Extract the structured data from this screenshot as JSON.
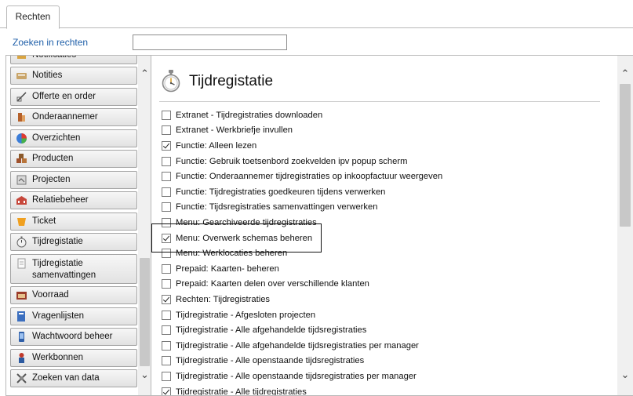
{
  "tabs": {
    "active_label": "Rechten"
  },
  "search": {
    "label": "Zoeken in rechten",
    "value": "",
    "placeholder": ""
  },
  "sidebar": {
    "items": [
      {
        "label": "Notificaties",
        "icon": "bell-icon"
      },
      {
        "label": "Notities",
        "icon": "note-icon"
      },
      {
        "label": "Offerte en order",
        "icon": "quote-icon"
      },
      {
        "label": "Onderaannemer",
        "icon": "subcontractor-icon"
      },
      {
        "label": "Overzichten",
        "icon": "pie-chart-icon"
      },
      {
        "label": "Producten",
        "icon": "boxes-icon"
      },
      {
        "label": "Projecten",
        "icon": "project-icon"
      },
      {
        "label": "Relatiebeheer",
        "icon": "buildings-icon"
      },
      {
        "label": "Ticket",
        "icon": "ticket-icon"
      },
      {
        "label": "Tijdregistatie",
        "icon": "stopwatch-icon"
      },
      {
        "label": "Tijdregistatie samenvattingen",
        "line1": "Tijdregistatie",
        "line2": "samenvattingen",
        "icon": "summary-icon"
      },
      {
        "label": "Voorraad",
        "icon": "store-icon"
      },
      {
        "label": "Vragenlijsten",
        "icon": "questionnaire-icon"
      },
      {
        "label": "Wachtwoord beheer",
        "icon": "phone-icon"
      },
      {
        "label": "Werkbonnen",
        "icon": "worker-icon"
      },
      {
        "label": "Zoeken van data",
        "icon": "search-data-icon"
      }
    ]
  },
  "main": {
    "title": "Tijdregistatie",
    "title_icon": "stopwatch-icon",
    "permissions": [
      {
        "label": "Extranet - Tijdregistraties downloaden",
        "checked": false
      },
      {
        "label": "Extranet - Werkbriefje invullen",
        "checked": false
      },
      {
        "label": "Functie: Alleen lezen",
        "checked": true
      },
      {
        "label": "Functie: Gebruik toetsenbord zoekvelden ipv popup scherm",
        "checked": false
      },
      {
        "label": "Functie: Onderaannemer tijdregistraties op inkoopfactuur weergeven",
        "checked": false
      },
      {
        "label": "Functie: Tijdregistraties goedkeuren tijdens verwerken",
        "checked": false
      },
      {
        "label": "Functie: Tijdsregistraties samenvattingen verwerken",
        "checked": false
      },
      {
        "label": "Menu: Gearchiveerde tijdregistraties",
        "checked": false
      },
      {
        "label": "Menu: Overwerk schemas beheren",
        "checked": true
      },
      {
        "label": "Menu: Werklocaties beheren",
        "checked": false
      },
      {
        "label": "Prepaid: Kaarten- beheren",
        "checked": false
      },
      {
        "label": "Prepaid: Kaarten delen over verschillende klanten",
        "checked": false
      },
      {
        "label": "Rechten: Tijdregistraties",
        "checked": true
      },
      {
        "label": "Tijdregistratie - Afgesloten projecten",
        "checked": false
      },
      {
        "label": "Tijdregistratie - Alle afgehandelde tijdsregistraties",
        "checked": false
      },
      {
        "label": "Tijdregistratie - Alle afgehandelde tijdsregistraties per manager",
        "checked": false
      },
      {
        "label": "Tijdregistratie - Alle openstaande tijdsregistraties",
        "checked": false
      },
      {
        "label": "Tijdregistratie - Alle openstaande tijdsregistraties per manager",
        "checked": false
      },
      {
        "label": "Tijdregistratie - Alle tijdregistraties",
        "checked": true
      }
    ]
  }
}
